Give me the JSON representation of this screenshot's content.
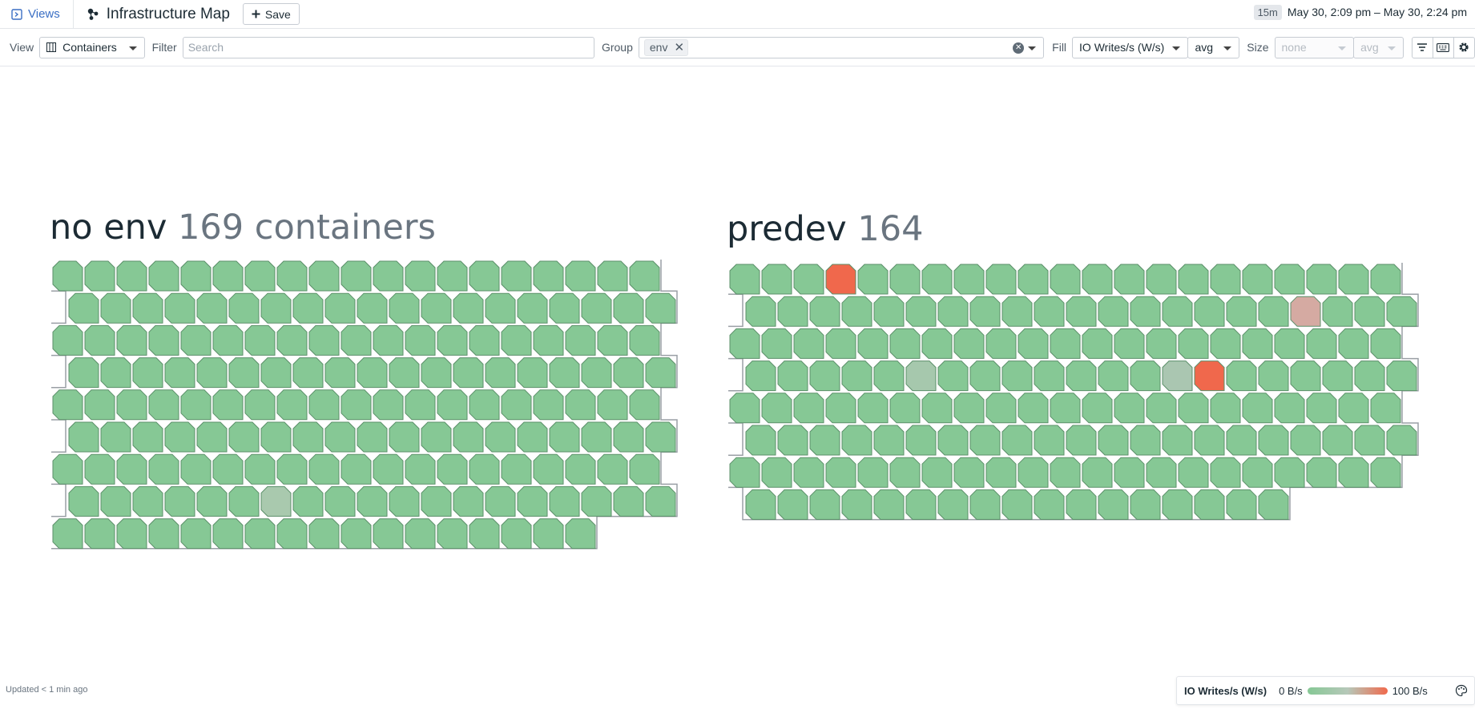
{
  "header": {
    "views_label": "Views",
    "title": "Infrastructure Map",
    "save_label": "Save",
    "time_badge": "15m",
    "time_range": "May 30, 2:09 pm – May 30, 2:24 pm"
  },
  "controls": {
    "view_label": "View",
    "view_value": "Containers",
    "filter_label": "Filter",
    "filter_placeholder": "Search",
    "group_label": "Group",
    "group_tag": "env",
    "fill_label": "Fill",
    "fill_metric": "IO Writes/s (W/s)",
    "fill_agg": "avg",
    "size_label": "Size",
    "size_metric": "none",
    "size_agg": "avg"
  },
  "groups": [
    {
      "name": "no env",
      "count": "169 containers",
      "rows": [
        19,
        19,
        19,
        19,
        19,
        19,
        19,
        19,
        17
      ],
      "highlights": [
        {
          "row": 7,
          "col": 6,
          "color": "#a9c9ae"
        }
      ]
    },
    {
      "name": "predev",
      "count": "164",
      "rows": [
        21,
        21,
        21,
        21,
        21,
        21,
        21,
        17
      ],
      "highlights": [
        {
          "row": 0,
          "col": 3,
          "color": "#f0684c"
        },
        {
          "row": 1,
          "col": 17,
          "color": "#d5aaa2"
        },
        {
          "row": 3,
          "col": 5,
          "color": "#a6c8ad"
        },
        {
          "row": 3,
          "col": 13,
          "color": "#aac6b1"
        },
        {
          "row": 3,
          "col": 14,
          "color": "#f0684c"
        }
      ]
    }
  ],
  "colors": {
    "hex_fill": "#86c895",
    "hex_stroke": "#5b8f69",
    "legend_low": "#86c895",
    "legend_high": "#f06a4d"
  },
  "footer": {
    "updated": "Updated < 1 min ago",
    "legend_title": "IO Writes/s (W/s)",
    "legend_min": "0 B/s",
    "legend_max": "100 B/s"
  }
}
